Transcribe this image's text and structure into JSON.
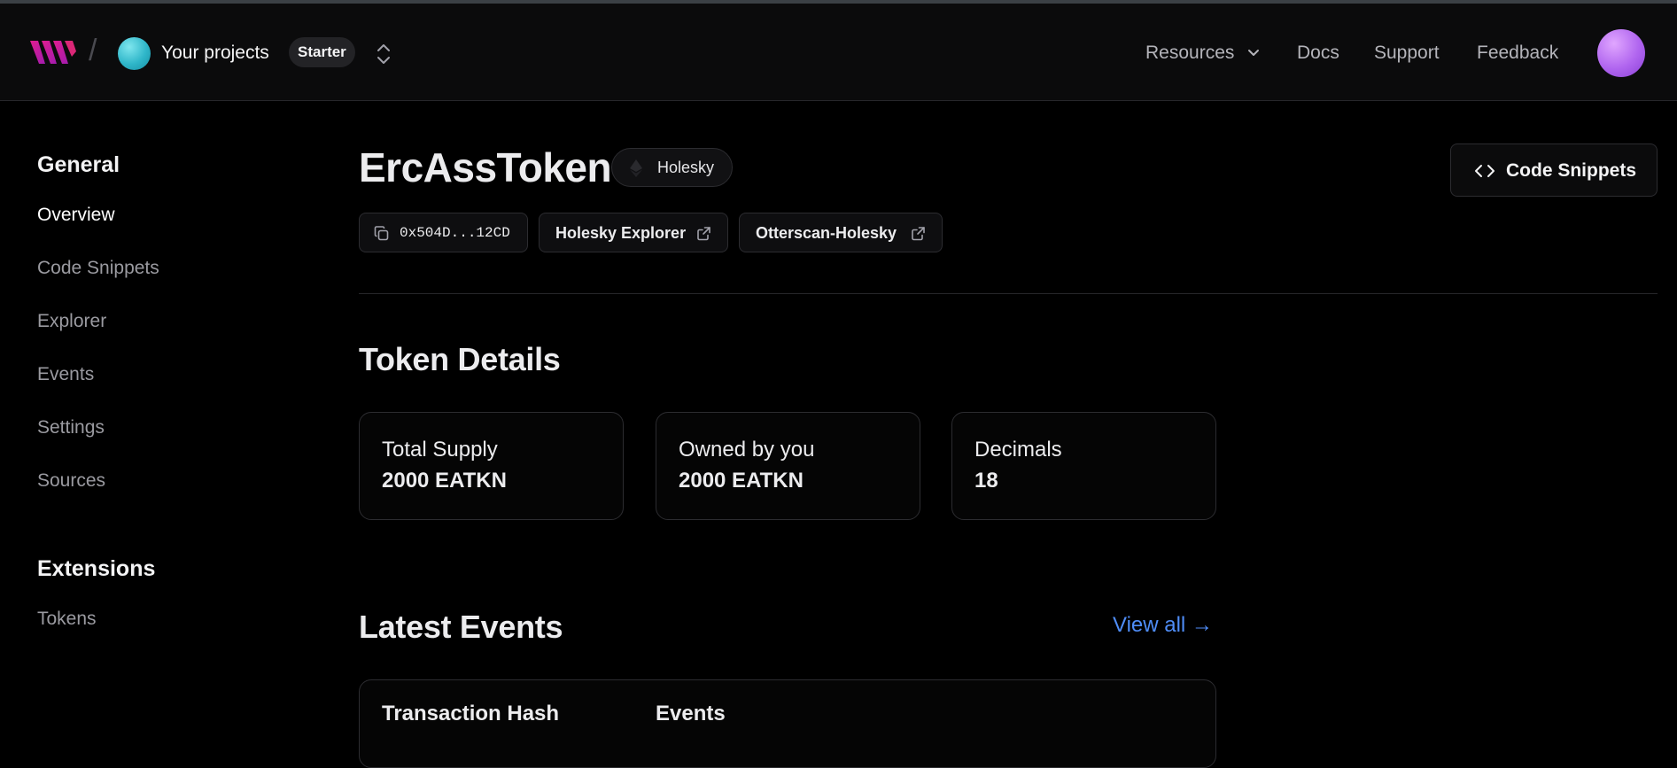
{
  "header": {
    "logo_icon": "brand-logo-icon",
    "project_title": "Your projects",
    "plan": "Starter",
    "switcher_icon": "chevron-up-down-icon",
    "nav": {
      "resources": "Resources",
      "docs": "Docs",
      "support": "Support",
      "feedback": "Feedback"
    },
    "avatar_icon": "user-avatar"
  },
  "sidebar": {
    "general_heading": "General",
    "general_items": [
      "Overview",
      "Code Snippets",
      "Explorer",
      "Events",
      "Settings",
      "Sources"
    ],
    "active_item": "Overview",
    "extensions_heading": "Extensions",
    "extensions_items": [
      "Tokens"
    ]
  },
  "token": {
    "name": "ErcAssToken",
    "network": "Holesky",
    "network_icon": "ethereum-icon",
    "address": "0x504D...12CD",
    "copy_icon": "copy-icon",
    "explorer_links": [
      "Holesky Explorer",
      "Otterscan-Holesky"
    ],
    "external_icon": "external-link-icon"
  },
  "actions": {
    "code_snippets": "Code Snippets",
    "code_icon": "code-icon"
  },
  "token_details": {
    "title": "Token Details",
    "cards": [
      {
        "label": "Total Supply",
        "value": "2000 EATKN"
      },
      {
        "label": "Owned by you",
        "value": "2000 EATKN"
      },
      {
        "label": "Decimals",
        "value": "18"
      }
    ]
  },
  "latest_events": {
    "title": "Latest Events",
    "view_all": "View all →",
    "columns": [
      "Transaction Hash",
      "Events"
    ]
  },
  "colors": {
    "background": "#000000",
    "header_bg": "#0b0b0c",
    "border": "#2c2c30",
    "link": "#4f8df7",
    "brand": "#c026d3"
  }
}
